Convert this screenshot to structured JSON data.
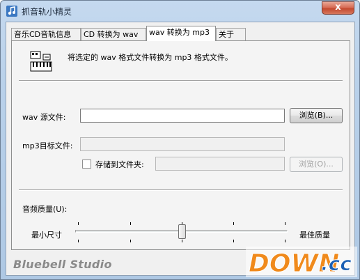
{
  "window": {
    "title": "抓音轨小精灵",
    "close_label": "x"
  },
  "tabs": [
    {
      "label": "音乐CD音轨信息",
      "active": false
    },
    {
      "label": "CD 转换为 wav",
      "active": false
    },
    {
      "label": "wav 转换为 mp3",
      "active": true
    },
    {
      "label": "关于",
      "active": false
    }
  ],
  "panel": {
    "description": "将选定的 wav 格式文件转换为 mp3 格式文件。",
    "source_label": "wav 源文件:",
    "source_value": "",
    "browse_label": "浏览(B)...",
    "target_label": "mp3目标文件:",
    "target_value": "",
    "save_to_folder_label": "存储到文件夹:",
    "save_to_folder_checked": false,
    "folder_value": "",
    "browse_folder_label": "浏览(O)...",
    "quality_label": "音频质量(U):",
    "min_label": "最小尺寸",
    "max_label": "最佳质量",
    "quality_level": 0.5
  },
  "footer": {
    "brand": "Bluebell Studio"
  },
  "watermark": {
    "text": "DOWN",
    "suffix": ".cc"
  },
  "colors": {
    "title_bar": "#b9d1ea",
    "close_button": "#c44a2f",
    "watermark_orange": "#f08a1c",
    "watermark_blue": "#1a5fb4"
  }
}
